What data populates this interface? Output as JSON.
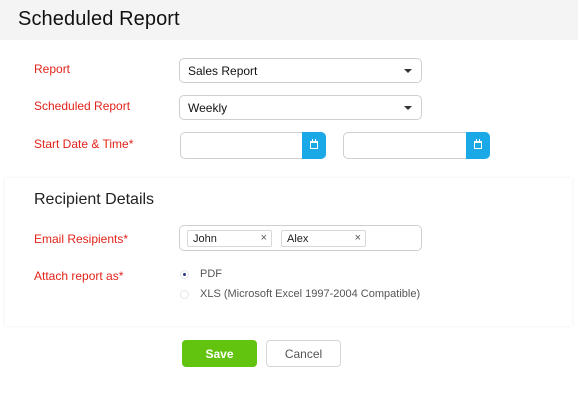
{
  "header": {
    "title": "Scheduled Report"
  },
  "form": {
    "report_label": "Report",
    "report_value": "Sales Report",
    "schedule_label": "Scheduled Report",
    "schedule_value": "Weekly",
    "start_label": "Start Date & Time*"
  },
  "recipients": {
    "section_title": "Recipient Details",
    "email_label": "Email Resipients*",
    "emails": [
      "John",
      "Alex"
    ],
    "attach_label": "Attach report as*",
    "options": [
      {
        "label": "PDF",
        "selected": true
      },
      {
        "label": "XLS (Microsoft Excel 1997-2004 Compatible)",
        "selected": false
      }
    ]
  },
  "actions": {
    "save_label": "Save",
    "cancel_label": "Cancel"
  },
  "colors": {
    "required_label": "#e2231a",
    "calendar_button": "#1ba8e6",
    "save_button": "#62c40f"
  },
  "icons": {
    "dropdown": "caret-down-icon",
    "calendar": "calendar-icon",
    "remove_tag": "close-icon"
  }
}
